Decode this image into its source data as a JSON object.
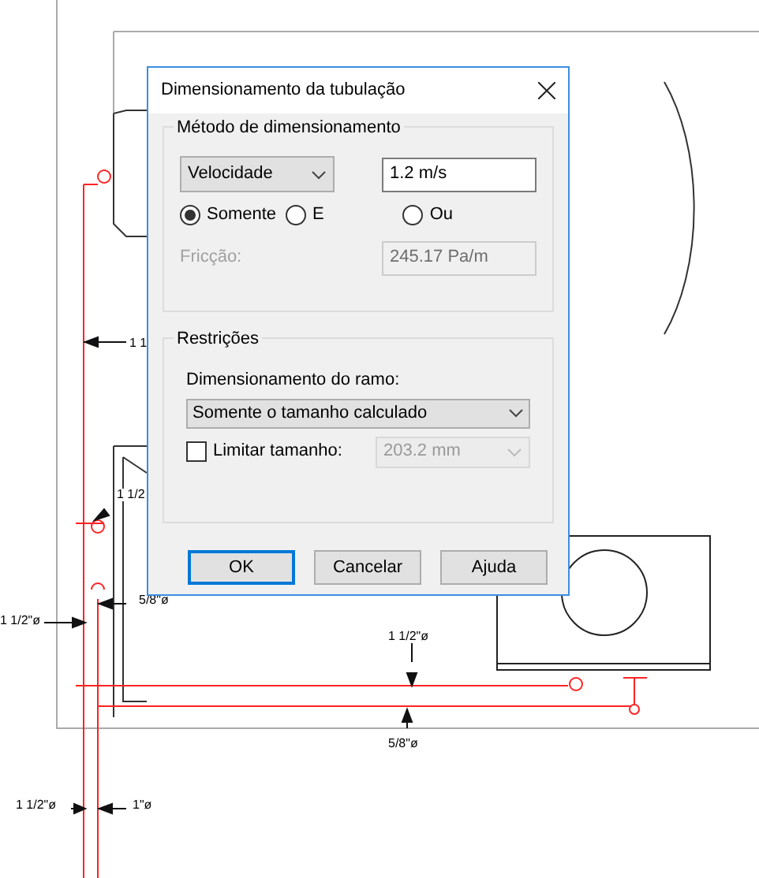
{
  "drawing": {
    "labels": [
      "1 1",
      "1 1/2",
      "5/8\"ø",
      "1 1/2\"ø",
      "1 1/2\"ø",
      "5/8\"ø",
      "1 1/2\"ø",
      "1\"ø"
    ]
  },
  "dialog": {
    "title": "Dimensionamento da tubulação",
    "method_group": {
      "title": "Método de dimensionamento",
      "method": "Velocidade",
      "value": "1.2 m/s",
      "radios": [
        {
          "label": "Somente",
          "selected": true
        },
        {
          "label": "E",
          "selected": false
        },
        {
          "label": "Ou",
          "selected": false
        }
      ],
      "friction": {
        "label": "Fricção:",
        "value": "245.17 Pa/m",
        "disabled": true
      }
    },
    "restrictions_group": {
      "title": "Restrições",
      "branch_label": "Dimensionamento do ramo:",
      "branch_value": "Somente o tamanho calculado",
      "limit": {
        "label": "Limitar tamanho:",
        "checked": false,
        "value": "203.2 mm"
      }
    },
    "buttons": [
      {
        "label": "OK",
        "default": true
      },
      {
        "label": "Cancelar",
        "default": false
      },
      {
        "label": "Ajuda",
        "default": false
      }
    ]
  }
}
